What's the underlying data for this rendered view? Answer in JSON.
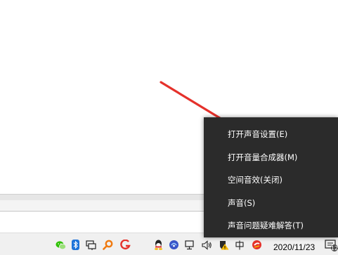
{
  "context_menu": {
    "items": [
      {
        "label": "打开声音设置(E)"
      },
      {
        "label": "打开音量合成器(M)"
      },
      {
        "label": "空间音效(关闭)"
      },
      {
        "label": "声音(S)"
      },
      {
        "label": "声音问题疑难解答(T)"
      }
    ]
  },
  "taskbar": {
    "clock_date": "2020/11/23",
    "tray_icons": [
      "wechat-icon",
      "bluetooth-icon",
      "network-monitor-icon",
      "search-orange-icon",
      "app-red-g-icon",
      "qq-icon",
      "app-blue-icon",
      "network-icon",
      "volume-icon",
      "warning-shield-icon",
      "input-method-icon",
      "app-red-icon",
      "notification-center-icon"
    ]
  },
  "colors": {
    "menu_background": "#2b2b2b",
    "menu_text": "#ffffff",
    "arrow": "#e5312b",
    "taskbar": "#f0f0f0"
  }
}
